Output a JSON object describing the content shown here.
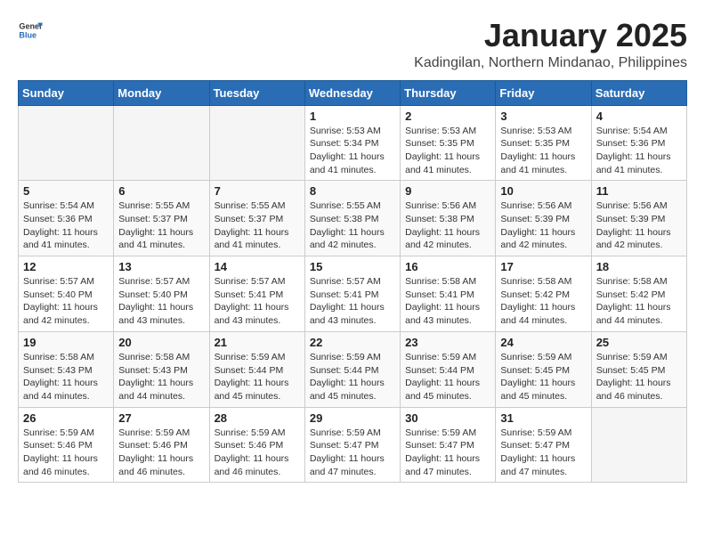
{
  "header": {
    "logo_general": "General",
    "logo_blue": "Blue",
    "title": "January 2025",
    "subtitle": "Kadingilan, Northern Mindanao, Philippines"
  },
  "weekdays": [
    "Sunday",
    "Monday",
    "Tuesday",
    "Wednesday",
    "Thursday",
    "Friday",
    "Saturday"
  ],
  "weeks": [
    [
      {
        "day": "",
        "sunrise": "",
        "sunset": "",
        "daylight": ""
      },
      {
        "day": "",
        "sunrise": "",
        "sunset": "",
        "daylight": ""
      },
      {
        "day": "",
        "sunrise": "",
        "sunset": "",
        "daylight": ""
      },
      {
        "day": "1",
        "sunrise": "Sunrise: 5:53 AM",
        "sunset": "Sunset: 5:34 PM",
        "daylight": "Daylight: 11 hours and 41 minutes."
      },
      {
        "day": "2",
        "sunrise": "Sunrise: 5:53 AM",
        "sunset": "Sunset: 5:35 PM",
        "daylight": "Daylight: 11 hours and 41 minutes."
      },
      {
        "day": "3",
        "sunrise": "Sunrise: 5:53 AM",
        "sunset": "Sunset: 5:35 PM",
        "daylight": "Daylight: 11 hours and 41 minutes."
      },
      {
        "day": "4",
        "sunrise": "Sunrise: 5:54 AM",
        "sunset": "Sunset: 5:36 PM",
        "daylight": "Daylight: 11 hours and 41 minutes."
      }
    ],
    [
      {
        "day": "5",
        "sunrise": "Sunrise: 5:54 AM",
        "sunset": "Sunset: 5:36 PM",
        "daylight": "Daylight: 11 hours and 41 minutes."
      },
      {
        "day": "6",
        "sunrise": "Sunrise: 5:55 AM",
        "sunset": "Sunset: 5:37 PM",
        "daylight": "Daylight: 11 hours and 41 minutes."
      },
      {
        "day": "7",
        "sunrise": "Sunrise: 5:55 AM",
        "sunset": "Sunset: 5:37 PM",
        "daylight": "Daylight: 11 hours and 41 minutes."
      },
      {
        "day": "8",
        "sunrise": "Sunrise: 5:55 AM",
        "sunset": "Sunset: 5:38 PM",
        "daylight": "Daylight: 11 hours and 42 minutes."
      },
      {
        "day": "9",
        "sunrise": "Sunrise: 5:56 AM",
        "sunset": "Sunset: 5:38 PM",
        "daylight": "Daylight: 11 hours and 42 minutes."
      },
      {
        "day": "10",
        "sunrise": "Sunrise: 5:56 AM",
        "sunset": "Sunset: 5:39 PM",
        "daylight": "Daylight: 11 hours and 42 minutes."
      },
      {
        "day": "11",
        "sunrise": "Sunrise: 5:56 AM",
        "sunset": "Sunset: 5:39 PM",
        "daylight": "Daylight: 11 hours and 42 minutes."
      }
    ],
    [
      {
        "day": "12",
        "sunrise": "Sunrise: 5:57 AM",
        "sunset": "Sunset: 5:40 PM",
        "daylight": "Daylight: 11 hours and 42 minutes."
      },
      {
        "day": "13",
        "sunrise": "Sunrise: 5:57 AM",
        "sunset": "Sunset: 5:40 PM",
        "daylight": "Daylight: 11 hours and 43 minutes."
      },
      {
        "day": "14",
        "sunrise": "Sunrise: 5:57 AM",
        "sunset": "Sunset: 5:41 PM",
        "daylight": "Daylight: 11 hours and 43 minutes."
      },
      {
        "day": "15",
        "sunrise": "Sunrise: 5:57 AM",
        "sunset": "Sunset: 5:41 PM",
        "daylight": "Daylight: 11 hours and 43 minutes."
      },
      {
        "day": "16",
        "sunrise": "Sunrise: 5:58 AM",
        "sunset": "Sunset: 5:41 PM",
        "daylight": "Daylight: 11 hours and 43 minutes."
      },
      {
        "day": "17",
        "sunrise": "Sunrise: 5:58 AM",
        "sunset": "Sunset: 5:42 PM",
        "daylight": "Daylight: 11 hours and 44 minutes."
      },
      {
        "day": "18",
        "sunrise": "Sunrise: 5:58 AM",
        "sunset": "Sunset: 5:42 PM",
        "daylight": "Daylight: 11 hours and 44 minutes."
      }
    ],
    [
      {
        "day": "19",
        "sunrise": "Sunrise: 5:58 AM",
        "sunset": "Sunset: 5:43 PM",
        "daylight": "Daylight: 11 hours and 44 minutes."
      },
      {
        "day": "20",
        "sunrise": "Sunrise: 5:58 AM",
        "sunset": "Sunset: 5:43 PM",
        "daylight": "Daylight: 11 hours and 44 minutes."
      },
      {
        "day": "21",
        "sunrise": "Sunrise: 5:59 AM",
        "sunset": "Sunset: 5:44 PM",
        "daylight": "Daylight: 11 hours and 45 minutes."
      },
      {
        "day": "22",
        "sunrise": "Sunrise: 5:59 AM",
        "sunset": "Sunset: 5:44 PM",
        "daylight": "Daylight: 11 hours and 45 minutes."
      },
      {
        "day": "23",
        "sunrise": "Sunrise: 5:59 AM",
        "sunset": "Sunset: 5:44 PM",
        "daylight": "Daylight: 11 hours and 45 minutes."
      },
      {
        "day": "24",
        "sunrise": "Sunrise: 5:59 AM",
        "sunset": "Sunset: 5:45 PM",
        "daylight": "Daylight: 11 hours and 45 minutes."
      },
      {
        "day": "25",
        "sunrise": "Sunrise: 5:59 AM",
        "sunset": "Sunset: 5:45 PM",
        "daylight": "Daylight: 11 hours and 46 minutes."
      }
    ],
    [
      {
        "day": "26",
        "sunrise": "Sunrise: 5:59 AM",
        "sunset": "Sunset: 5:46 PM",
        "daylight": "Daylight: 11 hours and 46 minutes."
      },
      {
        "day": "27",
        "sunrise": "Sunrise: 5:59 AM",
        "sunset": "Sunset: 5:46 PM",
        "daylight": "Daylight: 11 hours and 46 minutes."
      },
      {
        "day": "28",
        "sunrise": "Sunrise: 5:59 AM",
        "sunset": "Sunset: 5:46 PM",
        "daylight": "Daylight: 11 hours and 46 minutes."
      },
      {
        "day": "29",
        "sunrise": "Sunrise: 5:59 AM",
        "sunset": "Sunset: 5:47 PM",
        "daylight": "Daylight: 11 hours and 47 minutes."
      },
      {
        "day": "30",
        "sunrise": "Sunrise: 5:59 AM",
        "sunset": "Sunset: 5:47 PM",
        "daylight": "Daylight: 11 hours and 47 minutes."
      },
      {
        "day": "31",
        "sunrise": "Sunrise: 5:59 AM",
        "sunset": "Sunset: 5:47 PM",
        "daylight": "Daylight: 11 hours and 47 minutes."
      },
      {
        "day": "",
        "sunrise": "",
        "sunset": "",
        "daylight": ""
      }
    ]
  ]
}
